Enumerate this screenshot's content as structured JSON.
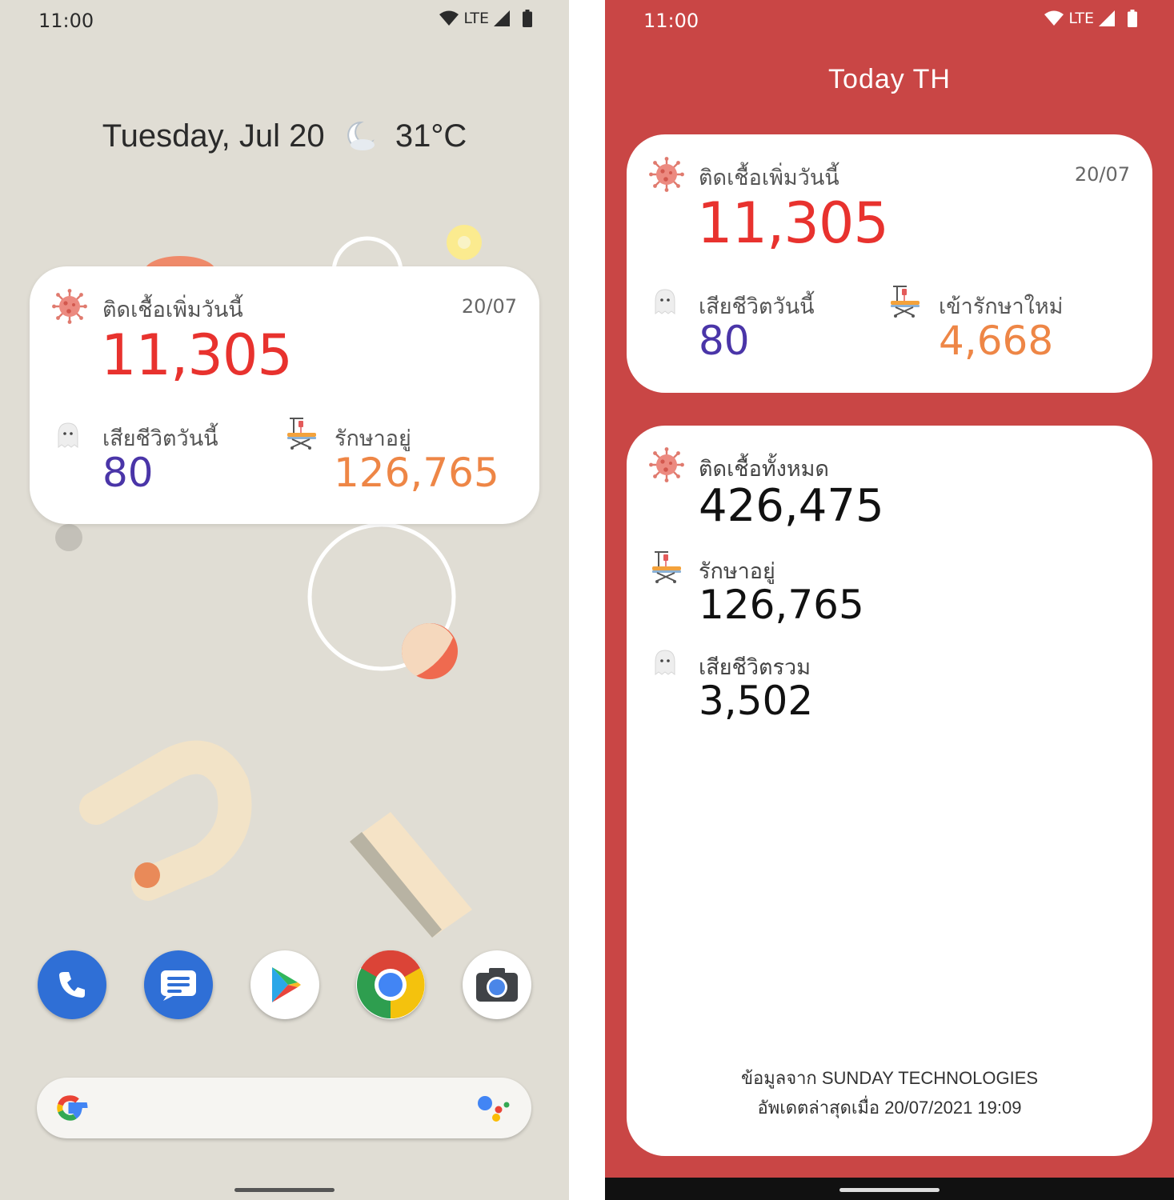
{
  "left": {
    "status": {
      "time": "11:00",
      "network": "LTE"
    },
    "glance": {
      "date": "Tuesday, Jul 20",
      "temp": "31°C"
    },
    "widget": {
      "date": "20/07",
      "new_cases": {
        "label": "ติดเชื้อเพิ่มวันนี้",
        "value": "11,305"
      },
      "deaths": {
        "label": "เสียชีวิตวันนี้",
        "value": "80"
      },
      "hospitalized": {
        "label": "รักษาอยู่",
        "value": "126,765"
      }
    },
    "dock": [
      "phone-icon",
      "messages-icon",
      "play-store-icon",
      "chrome-icon",
      "camera-icon"
    ]
  },
  "right": {
    "status": {
      "time": "11:00",
      "network": "LTE"
    },
    "title": "Today TH",
    "card1": {
      "date": "20/07",
      "new_cases": {
        "label": "ติดเชื้อเพิ่มวันนี้",
        "value": "11,305"
      },
      "deaths": {
        "label": "เสียชีวิตวันนี้",
        "value": "80"
      },
      "new_hospitalized": {
        "label": "เข้ารักษาใหม่",
        "value": "4,668"
      }
    },
    "card2": {
      "total_cases": {
        "label": "ติดเชื้อทั้งหมด",
        "value": "426,475"
      },
      "hospitalized": {
        "label": "รักษาอยู่",
        "value": "126,765"
      },
      "total_deaths": {
        "label": "เสียชีวิตรวม",
        "value": "3,502"
      },
      "footer_line1": "ข้อมูลจาก SUNDAY TECHNOLOGIES",
      "footer_line2": "อัพเดตล่าสุดเมื่อ 20/07/2021 19:09"
    }
  },
  "colors": {
    "red": "#e8322e",
    "purple": "#4a35a8",
    "orange": "#ee8646",
    "app_bg": "#c94645",
    "home_bg": "#e0ddd4"
  }
}
